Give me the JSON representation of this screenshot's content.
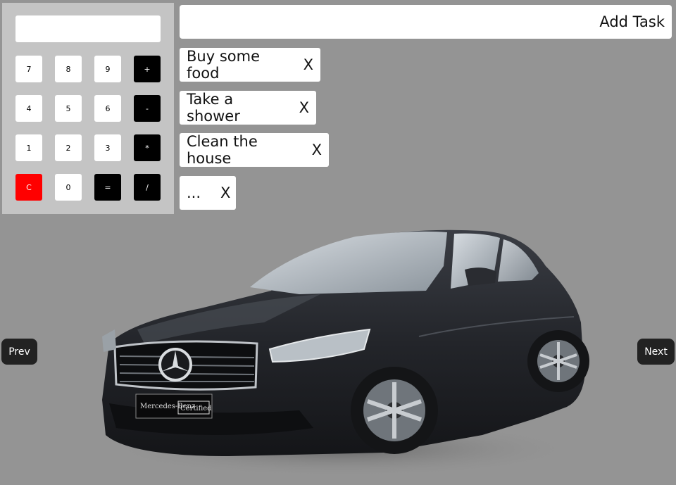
{
  "calculator": {
    "display": "",
    "keys": [
      {
        "label": "7",
        "kind": "num"
      },
      {
        "label": "8",
        "kind": "num"
      },
      {
        "label": "9",
        "kind": "num"
      },
      {
        "label": "+",
        "kind": "op"
      },
      {
        "label": "4",
        "kind": "num"
      },
      {
        "label": "5",
        "kind": "num"
      },
      {
        "label": "6",
        "kind": "num"
      },
      {
        "label": "-",
        "kind": "op"
      },
      {
        "label": "1",
        "kind": "num"
      },
      {
        "label": "2",
        "kind": "num"
      },
      {
        "label": "3",
        "kind": "num"
      },
      {
        "label": "*",
        "kind": "op"
      },
      {
        "label": "C",
        "kind": "clear"
      },
      {
        "label": "0",
        "kind": "num"
      },
      {
        "label": "=",
        "kind": "op"
      },
      {
        "label": "/",
        "kind": "op"
      }
    ]
  },
  "todo": {
    "add_label": "Add Task",
    "tasks": [
      {
        "text": "Buy some food",
        "delete": "X"
      },
      {
        "text": "Take a shower",
        "delete": "X"
      },
      {
        "text": "Clean the house",
        "delete": "X"
      },
      {
        "text": "...",
        "delete": "X"
      }
    ]
  },
  "carousel": {
    "prev": "Prev",
    "next": "Next",
    "badge_brand": "Mercedes-Benz",
    "badge_text": "Certified"
  },
  "colors": {
    "background": "#949494",
    "calc_panel": "#c4c4c4",
    "clear_key": "#ff0000",
    "op_key": "#000000"
  }
}
